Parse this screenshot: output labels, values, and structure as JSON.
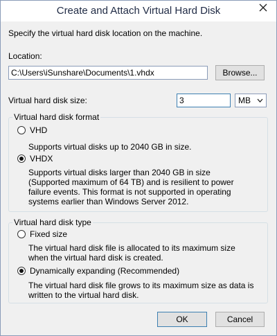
{
  "window": {
    "title": "Create and Attach Virtual Hard Disk"
  },
  "intro": "Specify the virtual hard disk location on the machine.",
  "location": {
    "label": "Location:",
    "value": "C:\\Users\\iSunshare\\Documents\\1.vhdx",
    "browse_label": "Browse..."
  },
  "size": {
    "label": "Virtual hard disk size:",
    "value": "3",
    "unit": "MB"
  },
  "format": {
    "legend": "Virtual hard disk format",
    "selected": "VHDX",
    "options": [
      {
        "label": "VHD",
        "description": "Supports virtual disks up to 2040 GB in size."
      },
      {
        "label": "VHDX",
        "description": "Supports virtual disks larger than 2040 GB in size (Supported maximum of 64 TB) and is resilient to power failure events. This format is not supported in operating systems earlier than Windows Server 2012."
      }
    ]
  },
  "type": {
    "legend": "Virtual hard disk type",
    "selected": "Dynamically expanding (Recommended)",
    "options": [
      {
        "label": "Fixed size",
        "description": "The virtual hard disk file is allocated to its maximum size when the virtual hard disk is created."
      },
      {
        "label": "Dynamically expanding (Recommended)",
        "description": "The virtual hard disk file grows to its maximum size as data is written to the virtual hard disk."
      }
    ]
  },
  "buttons": {
    "ok": "OK",
    "cancel": "Cancel"
  }
}
